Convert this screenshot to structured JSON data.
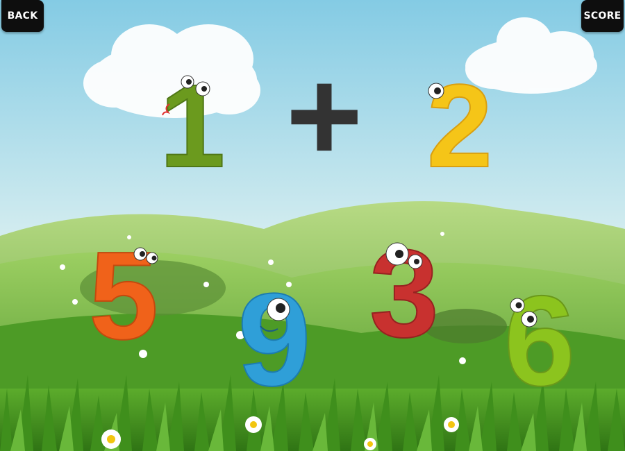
{
  "game": {
    "back_label": "BACK",
    "score_label": "SCORE",
    "equation": {
      "left": "1",
      "operator": "+",
      "right": "2"
    },
    "answer_choices": [
      "5",
      "9",
      "3",
      "6"
    ]
  },
  "colors": {
    "sky_top": "#8fd0e6",
    "sky_bottom": "#e8f4e8",
    "hill_green": "#6fae3e",
    "grass_green": "#3e8c1e",
    "number_one": "#6b9a1e",
    "number_two": "#f5c518",
    "number_five": "#f0621a",
    "number_nine": "#2f9fd8",
    "number_three": "#c8312f",
    "number_six": "#8cc41e"
  },
  "icons": [
    "back-button",
    "score-button",
    "plus-icon",
    "cloud",
    "flower"
  ]
}
